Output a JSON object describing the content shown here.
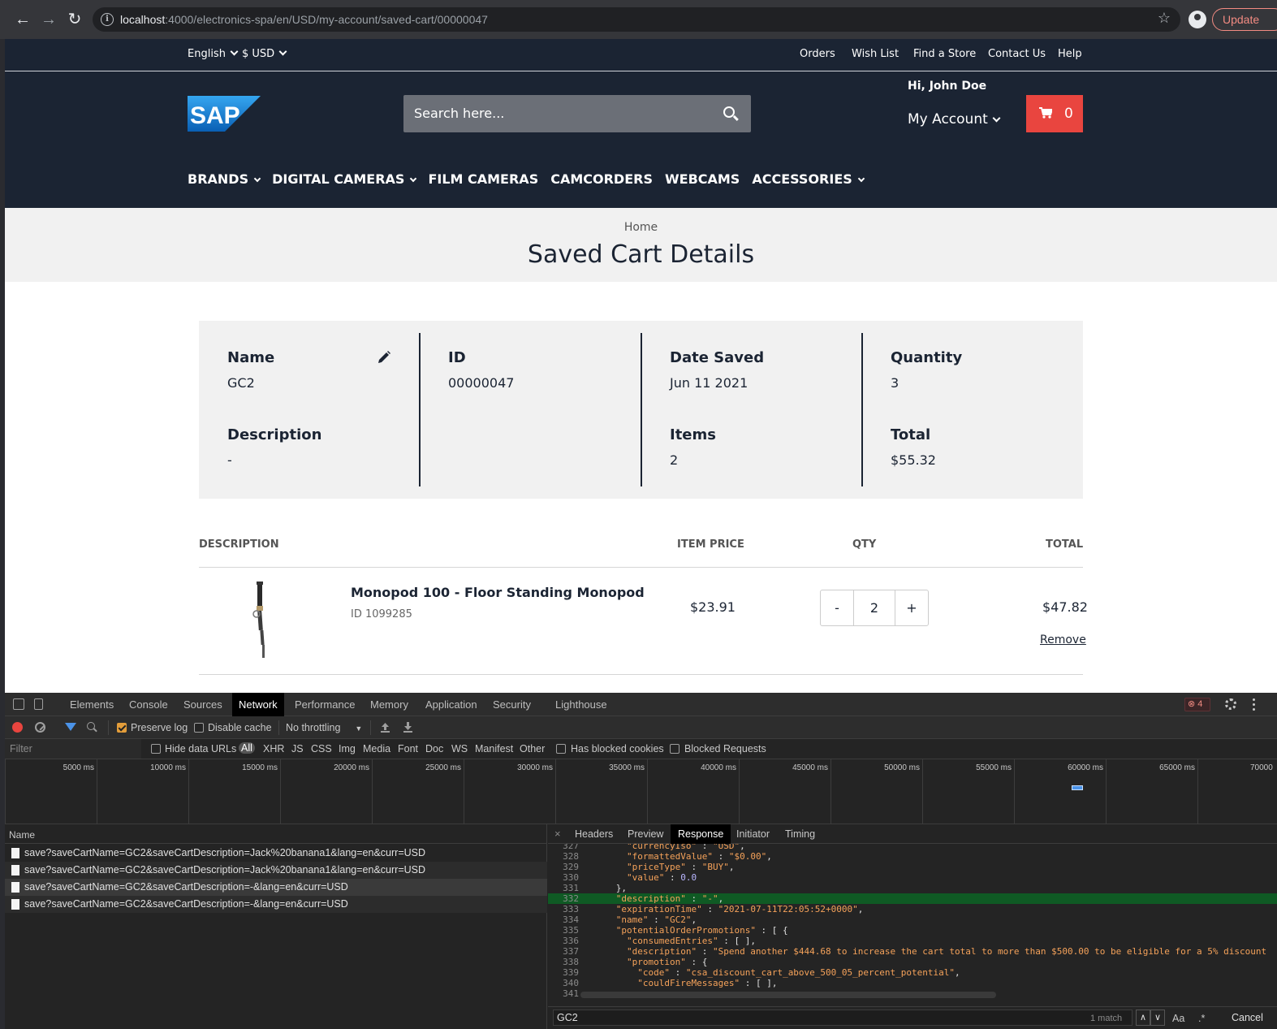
{
  "browser": {
    "url_host": "localhost",
    "url_path": ":4000/electronics-spa/en/USD/my-account/saved-cart/00000047",
    "update_label": "Update"
  },
  "site": {
    "language": "English",
    "currency": "$ USD",
    "top_links": [
      "Orders",
      "Wish List",
      "Find a Store",
      "Contact Us",
      "Help"
    ],
    "logo_text": "SAP",
    "search_placeholder": "Search here...",
    "greeting": "Hi, John Doe",
    "my_account": "My Account",
    "cart_count": "0",
    "categories": [
      {
        "label": "BRANDS",
        "has_menu": true
      },
      {
        "label": "DIGITAL CAMERAS",
        "has_menu": true
      },
      {
        "label": "FILM CAMERAS",
        "has_menu": false
      },
      {
        "label": "CAMCORDERS",
        "has_menu": false
      },
      {
        "label": "WEBCAMS",
        "has_menu": false
      },
      {
        "label": "ACCESSORIES",
        "has_menu": true
      }
    ],
    "breadcrumb": "Home",
    "page_title": "Saved Cart Details",
    "summary": {
      "name_label": "Name",
      "name_value": "GC2",
      "description_label": "Description",
      "description_value": "-",
      "id_label": "ID",
      "id_value": "00000047",
      "date_label": "Date Saved",
      "date_value": "Jun 11 2021",
      "items_label": "Items",
      "items_value": "2",
      "quantity_label": "Quantity",
      "quantity_value": "3",
      "total_label": "Total",
      "total_value": "$55.32"
    },
    "table": {
      "headers": [
        "DESCRIPTION",
        "ITEM PRICE",
        "QTY",
        "TOTAL"
      ],
      "product_name": "Monopod 100 - Floor Standing Monopod",
      "product_id": "ID 1099285",
      "item_price": "$23.91",
      "qty_minus": "-",
      "qty_value": "2",
      "qty_plus": "+",
      "line_total": "$47.82",
      "remove_label": "Remove"
    }
  },
  "devtools": {
    "tabs": [
      "Elements",
      "Console",
      "Sources",
      "Network",
      "Performance",
      "Memory",
      "Application",
      "Security",
      "Lighthouse"
    ],
    "active_tab": "Network",
    "error_count": "4",
    "toolbar": {
      "preserve_log": "Preserve log",
      "disable_cache": "Disable cache",
      "throttling": "No throttling"
    },
    "filter": {
      "placeholder": "Filter",
      "hide_data_urls": "Hide data URLs",
      "types": [
        "All",
        "XHR",
        "JS",
        "CSS",
        "Img",
        "Media",
        "Font",
        "Doc",
        "WS",
        "Manifest",
        "Other"
      ],
      "has_blocked_cookies": "Has blocked cookies",
      "blocked_requests": "Blocked Requests"
    },
    "timeline_ticks": [
      "5000 ms",
      "10000 ms",
      "15000 ms",
      "20000 ms",
      "25000 ms",
      "30000 ms",
      "35000 ms",
      "40000 ms",
      "45000 ms",
      "50000 ms",
      "55000 ms",
      "60000 ms",
      "65000 ms",
      "70000"
    ],
    "name_header": "Name",
    "requests": [
      "save?saveCartName=GC2&saveCartDescription=Jack%20banana1&lang=en&curr=USD",
      "save?saveCartName=GC2&saveCartDescription=Jack%20banana1&lang=en&curr=USD",
      "save?saveCartName=GC2&saveCartDescription=-&lang=en&curr=USD",
      "save?saveCartName=GC2&saveCartDescription=-&lang=en&curr=USD"
    ],
    "detail_tabs": [
      "Headers",
      "Preview",
      "Response",
      "Initiator",
      "Timing"
    ],
    "active_detail_tab": "Response",
    "code_lines": [
      {
        "n": "327",
        "t": "        \"currencyIso\" : \"USD\","
      },
      {
        "n": "328",
        "t": "        \"formattedValue\" : \"$0.00\","
      },
      {
        "n": "329",
        "t": "        \"priceType\" : \"BUY\","
      },
      {
        "n": "330",
        "t": "        \"value\" : 0.0"
      },
      {
        "n": "331",
        "t": "      },"
      },
      {
        "n": "332",
        "t": "      \"description\" : \"-\","
      },
      {
        "n": "333",
        "t": "      \"expirationTime\" : \"2021-07-11T22:05:52+0000\","
      },
      {
        "n": "334",
        "t": "      \"name\" : \"GC2\","
      },
      {
        "n": "335",
        "t": "      \"potentialOrderPromotions\" : [ {"
      },
      {
        "n": "336",
        "t": "        \"consumedEntries\" : [ ],"
      },
      {
        "n": "337",
        "t": "        \"description\" : \"Spend another $444.68 to increase the cart total to more than $500.00 to be eligible for a 5% discount"
      },
      {
        "n": "338",
        "t": "        \"promotion\" : {"
      },
      {
        "n": "339",
        "t": "          \"code\" : \"csa_discount_cart_above_500_05_percent_potential\","
      },
      {
        "n": "340",
        "t": "          \"couldFireMessages\" : [ ],"
      },
      {
        "n": "341",
        "t": ""
      }
    ],
    "highlight_line": "332",
    "find": {
      "query": "GC2",
      "matches": "1 match",
      "match_case": "Aa",
      "regex": ".*",
      "cancel": "Cancel"
    }
  },
  "colors": {
    "header_bg": "#1b2433",
    "cart_red": "#e9453f",
    "sap_blue": "#1a79d1",
    "devtools_bg": "#242424",
    "code_key": "#f5a25a",
    "highlight_green": "#0f5a24"
  }
}
